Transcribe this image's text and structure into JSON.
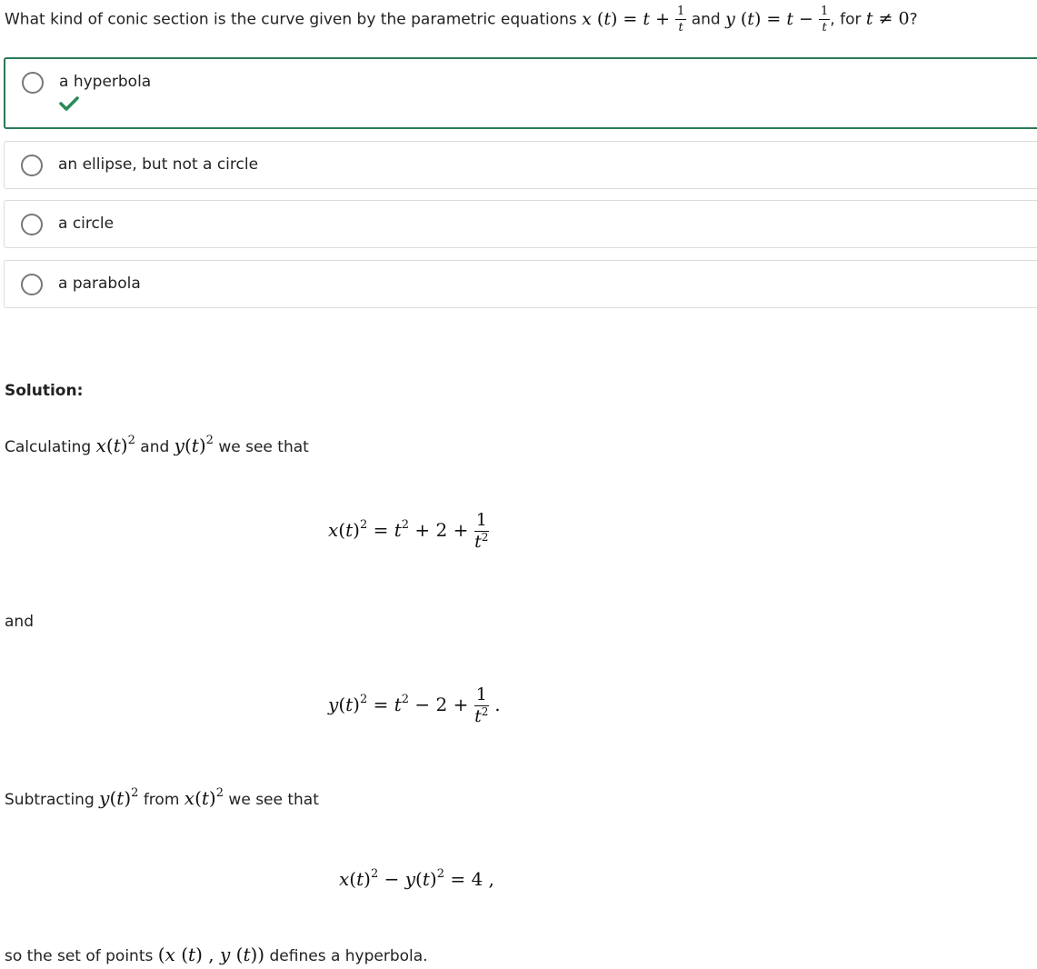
{
  "question": {
    "prefix": "What kind of conic section is the curve given by the parametric equations",
    "and": "and",
    "for_text": ", for",
    "qmark": "?"
  },
  "options": [
    {
      "label": "a hyperbola",
      "correct": true
    },
    {
      "label": "an ellipse, but not a circle",
      "correct": false
    },
    {
      "label": "a circle",
      "correct": false
    },
    {
      "label": "a parabola",
      "correct": false
    }
  ],
  "solution": {
    "heading": "Solution:",
    "line1_a": "Calculating",
    "line1_b": "and",
    "line1_c": "we see that",
    "and_word": "and",
    "line2_a": "Subtracting",
    "line2_b": "from",
    "line2_c": "we see that",
    "final_a": "so the set of points",
    "final_b": "defines a hyperbola."
  },
  "colors": {
    "correct_border": "#2b7a55",
    "check": "#2b8a5a"
  },
  "icons": {
    "check": "check-icon",
    "radio": "radio-icon"
  }
}
